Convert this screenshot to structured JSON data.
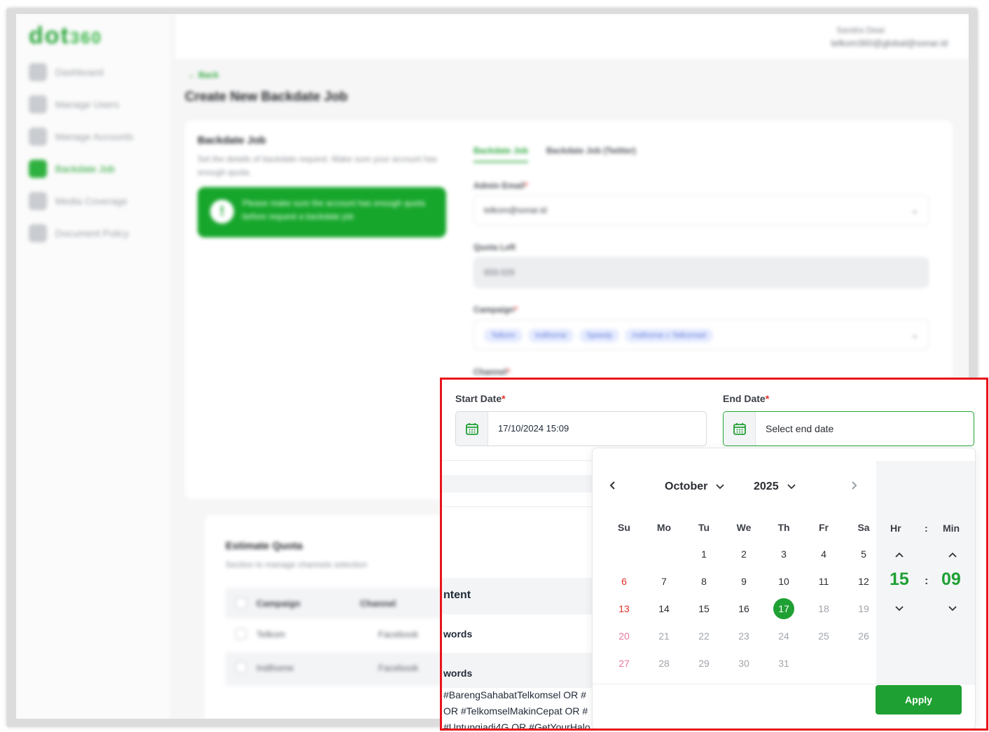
{
  "app": {
    "logo": "dot",
    "logo_suffix": "360",
    "user_name": "Sandra Dewi",
    "user_email": "telkom360@global@sonar.id"
  },
  "sidebar": {
    "items": [
      {
        "label": "Dashboard",
        "icon": "dashboard-icon"
      },
      {
        "label": "Manage Users",
        "icon": "users-icon"
      },
      {
        "label": "Manage Accounts",
        "icon": "accounts-icon"
      },
      {
        "label": "Backdate Job",
        "icon": "backdate-icon",
        "active": true
      },
      {
        "label": "Media Coverage",
        "icon": "media-icon"
      },
      {
        "label": "Document Policy",
        "icon": "document-icon"
      }
    ]
  },
  "page": {
    "back_label": "Back",
    "title": "Create New Backdate Job"
  },
  "backdate_card": {
    "title": "Backdate Job",
    "description": "Set the details of backdate request. Make sure your account has enough quota.",
    "alert": "Please make sure the account has enough quota before request a backdate job",
    "tabs": [
      "Backdate Job",
      "Backdate Job (Twitter)"
    ],
    "admin_email_label": "Admin Email",
    "admin_email_value": "telkom@sonar.id",
    "quota_left_label": "Quota Left",
    "quota_left_value": "659.029",
    "campaign_label": "Campaign",
    "campaign_chips": [
      "Telkom",
      "Indihome",
      "Speedy",
      "Indihome x Telkomsel"
    ],
    "channel_label": "Channel"
  },
  "estimate_card": {
    "title": "Estimate Quota",
    "description": "Section to manage channels selection",
    "columns": [
      "Campaign",
      "Channel"
    ],
    "rows": [
      {
        "campaign": "Telkom",
        "channel": "Facebook"
      },
      {
        "campaign": "Indihome",
        "channel": "Facebook"
      }
    ]
  },
  "date_range": {
    "start_label": "Start Date",
    "start_value": "17/10/2024 15:09",
    "end_label": "End Date",
    "end_placeholder": "Select end date",
    "required_mark": "*"
  },
  "background_text": {
    "content_label": "ntent",
    "keywords_label_1": "words",
    "keywords_label_2": "words",
    "keyword_lines": [
      "#BarengSahabatTelkomsel OR #",
      "OR #TelkomselMakinCepat OR #",
      "#Untungiadi4G OR #GetYourHalo"
    ]
  },
  "calendar": {
    "month": "October",
    "year": "2025",
    "weekdays": [
      "Su",
      "Mo",
      "Tu",
      "We",
      "Th",
      "Fr",
      "Sa"
    ],
    "weeks": [
      [
        "",
        "",
        "1",
        "2",
        "3",
        "4",
        "5"
      ],
      [
        "6",
        "7",
        "8",
        "9",
        "10",
        "11",
        "12"
      ],
      [
        "13",
        "14",
        "15",
        "16",
        "17",
        "18",
        "19"
      ],
      [
        "20",
        "21",
        "22",
        "23",
        "24",
        "25",
        "26"
      ],
      [
        "27",
        "28",
        "29",
        "30",
        "31",
        "",
        ""
      ]
    ],
    "selected_day": "17",
    "colors": {
      "accent": "#1fa033",
      "sunday": "#e2302b",
      "disabled": "#a0a4ab"
    }
  },
  "time": {
    "hour_label": "Hr",
    "minute_label": "Min",
    "separator": ":",
    "hour": "15",
    "minute": "09"
  },
  "actions": {
    "apply_label": "Apply"
  }
}
